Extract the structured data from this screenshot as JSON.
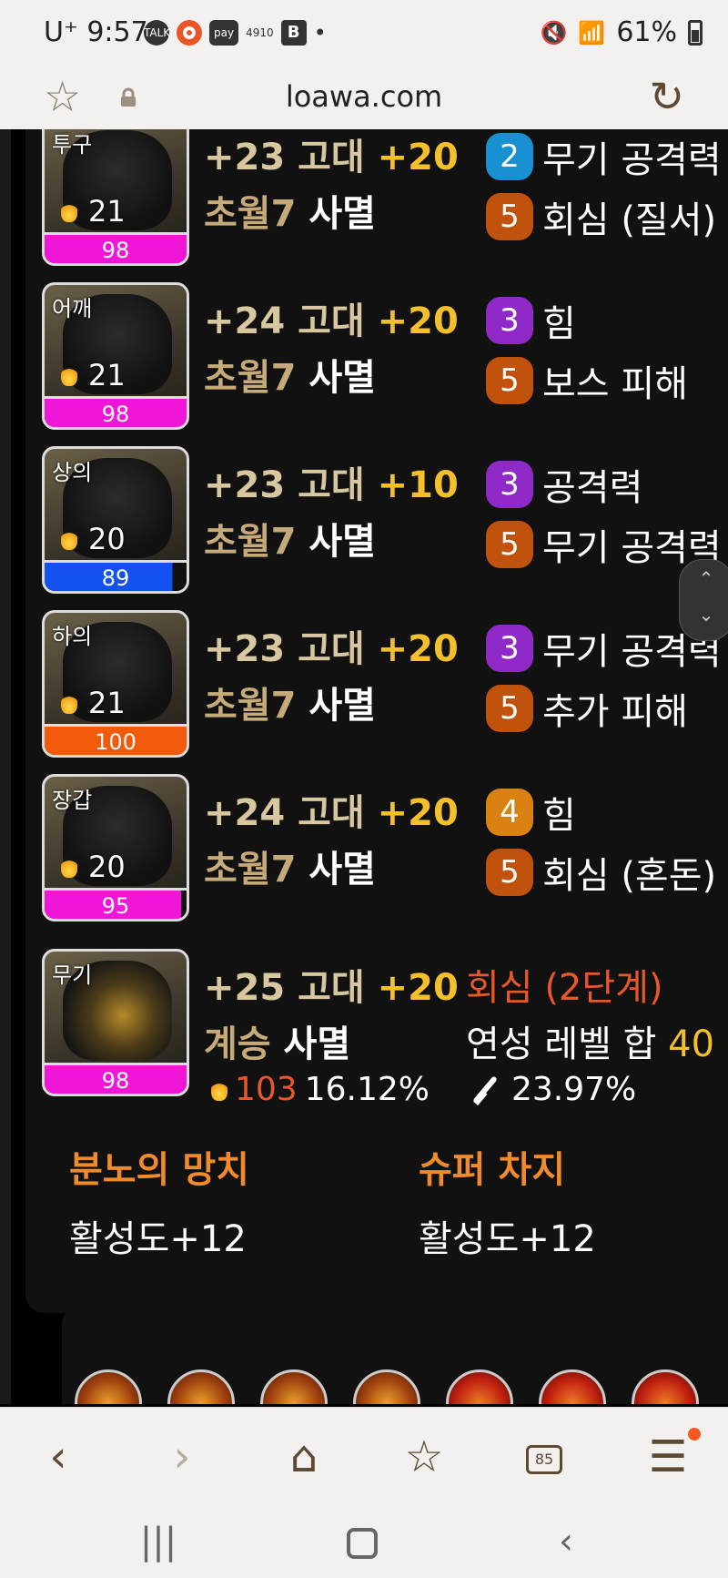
{
  "status_bar": {
    "carrier": "U⁺",
    "time": "9:57",
    "talk_label": "TALK",
    "pay_label": "pay",
    "pay_number": "4910",
    "b_label": "B",
    "dot": "•",
    "battery": "61%"
  },
  "browser": {
    "url": "loawa.com"
  },
  "equipment": [
    {
      "slot": "투구",
      "quality_num": "21",
      "bar_value": "98",
      "bar_fill": 1.0,
      "bar_color": "#f016d8",
      "enhance": "+23 고대",
      "bonus": "+20",
      "set_level": "초월7",
      "set_name": "사멸",
      "eff1_level": "2",
      "eff1_color": "#1990d0",
      "eff1_name": "무기 공격력",
      "eff2_level": "5",
      "eff2_color": "#c0520e",
      "eff2_name": "회심 (질서)"
    },
    {
      "slot": "어깨",
      "quality_num": "21",
      "bar_value": "98",
      "bar_fill": 1.0,
      "bar_color": "#f016d8",
      "enhance": "+24 고대",
      "bonus": "+20",
      "set_level": "초월7",
      "set_name": "사멸",
      "eff1_level": "3",
      "eff1_color": "#8f2ac8",
      "eff1_name": "힘",
      "eff2_level": "5",
      "eff2_color": "#c0520e",
      "eff2_name": "보스 피해"
    },
    {
      "slot": "상의",
      "quality_num": "20",
      "bar_value": "89",
      "bar_fill": 0.9,
      "bar_color": "#1452f0",
      "enhance": "+23 고대",
      "bonus": "+10",
      "set_level": "초월7",
      "set_name": "사멸",
      "eff1_level": "3",
      "eff1_color": "#8f2ac8",
      "eff1_name": "공격력",
      "eff2_level": "5",
      "eff2_color": "#c0520e",
      "eff2_name": "무기 공격력"
    },
    {
      "slot": "하의",
      "quality_num": "21",
      "bar_value": "100",
      "bar_fill": 1.0,
      "bar_color": "#f05a0a",
      "enhance": "+23 고대",
      "bonus": "+20",
      "set_level": "초월7",
      "set_name": "사멸",
      "eff1_level": "3",
      "eff1_color": "#8f2ac8",
      "eff1_name": "무기 공격력",
      "eff2_level": "5",
      "eff2_color": "#c0520e",
      "eff2_name": "추가 피해"
    },
    {
      "slot": "장갑",
      "quality_num": "20",
      "bar_value": "95",
      "bar_fill": 0.96,
      "bar_color": "#f016d8",
      "enhance": "+24 고대",
      "bonus": "+20",
      "set_level": "초월7",
      "set_name": "사멸",
      "eff1_level": "4",
      "eff1_color": "#d98212",
      "eff1_name": "힘",
      "eff2_level": "5",
      "eff2_color": "#c0520e",
      "eff2_name": "회심 (혼돈)"
    }
  ],
  "weapon": {
    "slot": "무기",
    "bar_value": "98",
    "bar_color": "#f016d8",
    "enhance": "+25 고대",
    "bonus": "+20",
    "type": "계승",
    "set_name": "사멸",
    "flame_num": "103",
    "flame_pct": "16.12%",
    "elixir": "회심 (2단계)",
    "elixir_sum_label": "연성 레벨 합",
    "elixir_sum_value": "40",
    "sword_pct": "23.97%"
  },
  "skills": [
    {
      "name": "분노의 망치",
      "value": "활성도+12"
    },
    {
      "name": "슈퍼 차지",
      "value": "활성도+12"
    }
  ],
  "scroll_widget": {
    "up": "⌃",
    "down": "⌄"
  },
  "toolbar": {
    "back": "‹",
    "forward": "›",
    "tabs_count": "85"
  }
}
